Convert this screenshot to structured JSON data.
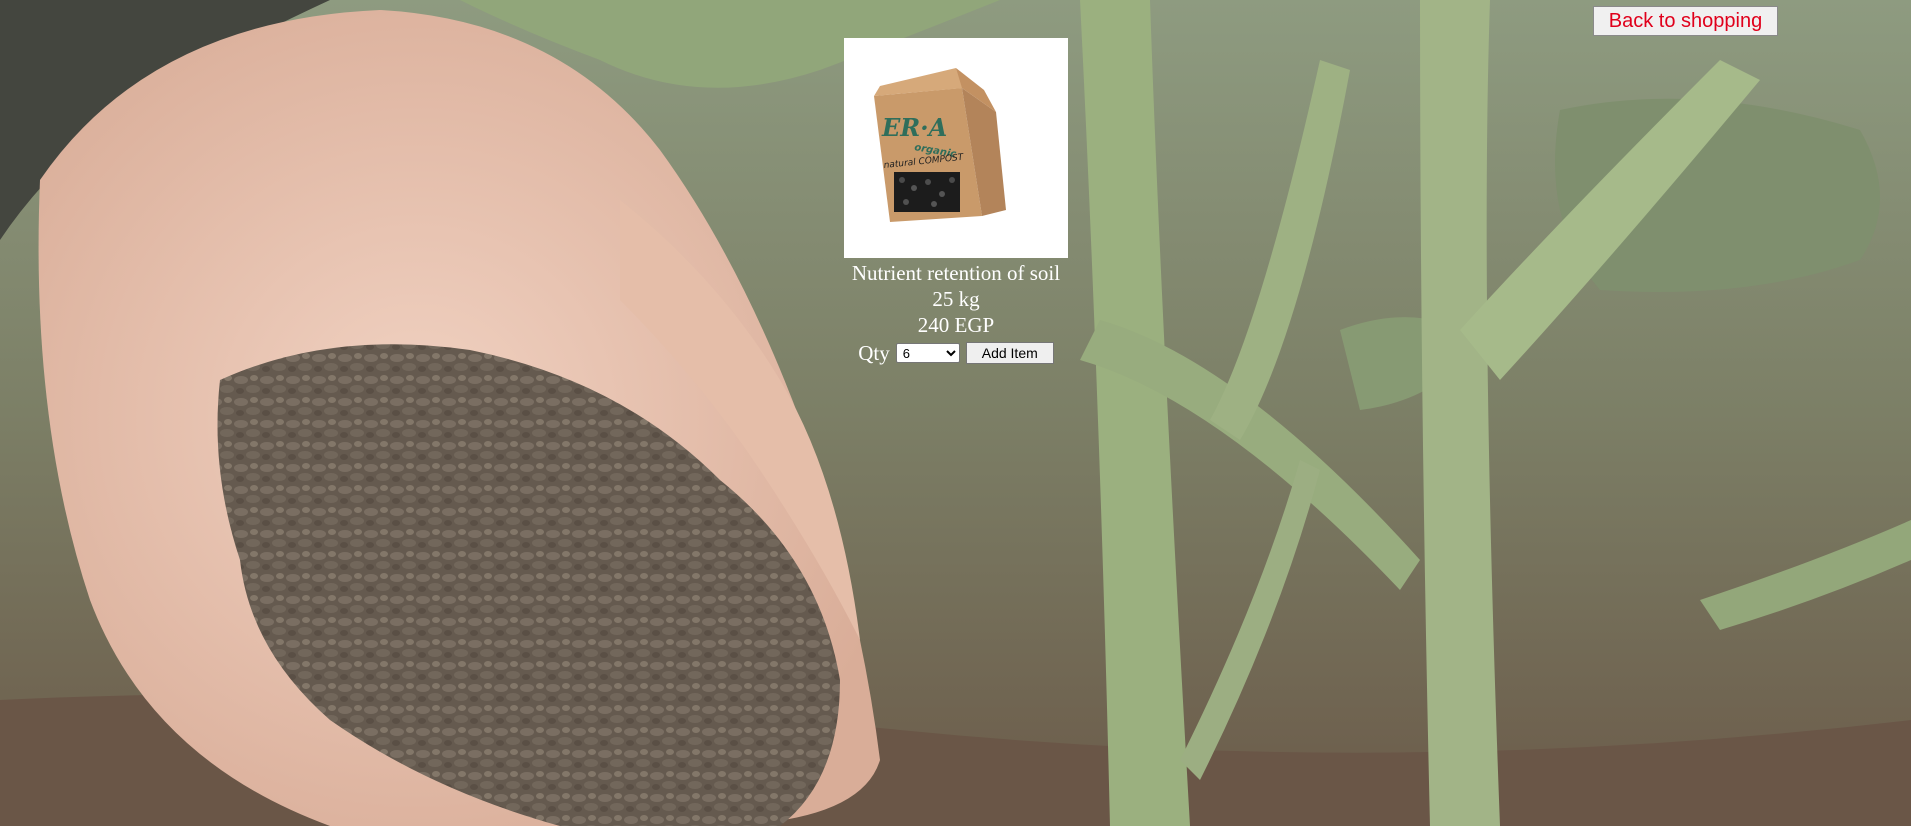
{
  "colors": {
    "background_tone": "#7e8067",
    "back_button_text": "#e0001b",
    "product_text": "#ffffff"
  },
  "background": {
    "depicts": "hand holding compost pellets beside green plant stems"
  },
  "header": {
    "back_label": "Back to shopping"
  },
  "product": {
    "image": {
      "brand_text": "ER·A",
      "brand_sub": "organic",
      "package_text": "natural COMPOST"
    },
    "name": "Nutrient retention of soil",
    "weight": "25 kg",
    "price": "240 EGP",
    "qty_label": "Qty",
    "qty_selected": "6",
    "add_label": "Add Item"
  }
}
